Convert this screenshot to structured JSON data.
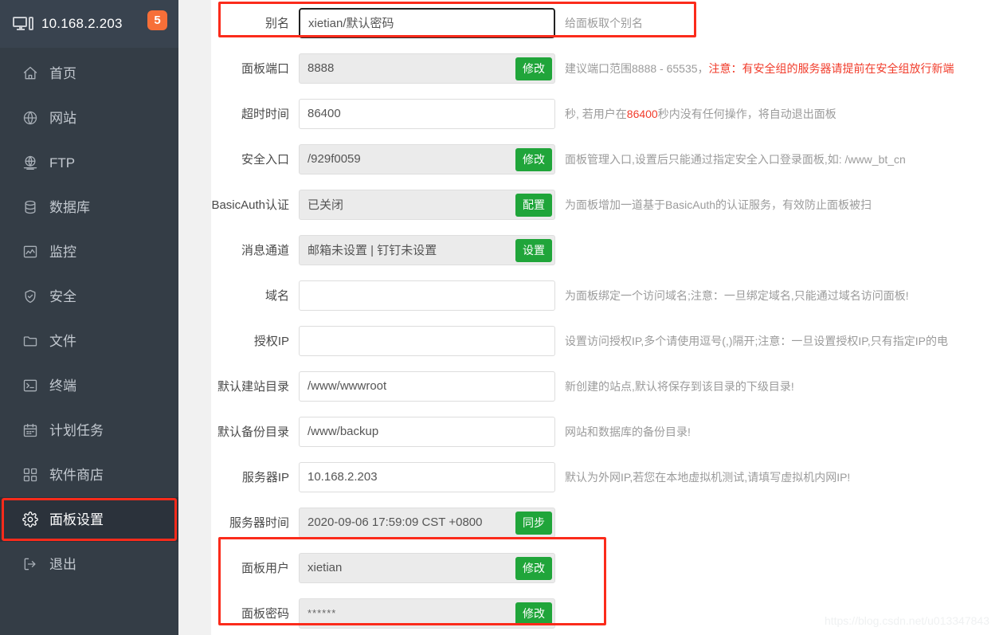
{
  "sidebar": {
    "host": "10.168.2.203",
    "badge": "5",
    "host_icon": "monitor-tower-icon",
    "items": [
      {
        "label": "首页",
        "icon": "home-icon",
        "active": false
      },
      {
        "label": "网站",
        "icon": "globe-icon",
        "active": false
      },
      {
        "label": "FTP",
        "icon": "ftp-globe-icon",
        "active": false
      },
      {
        "label": "数据库",
        "icon": "database-icon",
        "active": false
      },
      {
        "label": "监控",
        "icon": "chart-icon",
        "active": false
      },
      {
        "label": "安全",
        "icon": "shield-icon",
        "active": false
      },
      {
        "label": "文件",
        "icon": "folder-icon",
        "active": false
      },
      {
        "label": "终端",
        "icon": "terminal-icon",
        "active": false
      },
      {
        "label": "计划任务",
        "icon": "calendar-icon",
        "active": false
      },
      {
        "label": "软件商店",
        "icon": "grid-icon",
        "active": false
      },
      {
        "label": "面板设置",
        "icon": "gear-icon",
        "active": true
      },
      {
        "label": "退出",
        "icon": "logout-icon",
        "active": false
      }
    ]
  },
  "form": {
    "rows": [
      {
        "label": "别名",
        "value": "xietian/默认密码",
        "readonly": false,
        "focused": true,
        "button": null,
        "hint": "给面板取个别名",
        "hint_warn": null,
        "annotated": true
      },
      {
        "label": "面板端口",
        "value": "8888",
        "readonly": true,
        "focused": false,
        "button": "修改",
        "hint": "建议端口范围8888 - 65535，",
        "hint_warn": "注意：有安全组的服务器请提前在安全组放行新端",
        "annotated": false
      },
      {
        "label": "超时时间",
        "value": "86400",
        "readonly": false,
        "focused": false,
        "button": null,
        "hint": "秒, 若用户在",
        "hint_num": "86400",
        "hint_tail": "秒内没有任何操作，将自动退出面板",
        "annotated": false
      },
      {
        "label": "安全入口",
        "value": "/929f0059",
        "readonly": true,
        "focused": false,
        "button": "修改",
        "hint": "面板管理入口,设置后只能通过指定安全入口登录面板,如: /www_bt_cn",
        "annotated": false
      },
      {
        "label": "BasicAuth认证",
        "value": "已关闭",
        "readonly": true,
        "focused": false,
        "button": "配置",
        "hint": "为面板增加一道基于BasicAuth的认证服务，有效防止面板被扫",
        "annotated": false
      },
      {
        "label": "消息通道",
        "value": "邮箱未设置 | 钉钉未设置",
        "readonly": true,
        "focused": false,
        "button": "设置",
        "hint": "",
        "annotated": false
      },
      {
        "label": "域名",
        "value": "",
        "readonly": false,
        "focused": false,
        "button": null,
        "hint": "为面板绑定一个访问域名;注意：一旦绑定域名,只能通过域名访问面板!",
        "annotated": false
      },
      {
        "label": "授权IP",
        "value": "",
        "readonly": false,
        "focused": false,
        "button": null,
        "hint": "设置访问授权IP,多个请使用逗号(,)隔开;注意：一旦设置授权IP,只有指定IP的电",
        "annotated": false
      },
      {
        "label": "默认建站目录",
        "value": "/www/wwwroot",
        "readonly": false,
        "focused": false,
        "button": null,
        "hint": "新创建的站点,默认将保存到该目录的下级目录!",
        "annotated": false
      },
      {
        "label": "默认备份目录",
        "value": "/www/backup",
        "readonly": false,
        "focused": false,
        "button": null,
        "hint": "网站和数据库的备份目录!",
        "annotated": false
      },
      {
        "label": "服务器IP",
        "value": "10.168.2.203",
        "readonly": false,
        "focused": false,
        "button": null,
        "hint": "默认为外网IP,若您在本地虚拟机测试,请填写虚拟机内网IP!",
        "annotated": false
      },
      {
        "label": "服务器时间",
        "value": "2020-09-06 17:59:09 CST +0800",
        "readonly": true,
        "focused": false,
        "button": "同步",
        "hint": "",
        "annotated": false
      },
      {
        "label": "面板用户",
        "value": "xietian",
        "readonly": true,
        "focused": false,
        "button": "修改",
        "hint": "",
        "annotated": true
      },
      {
        "label": "面板密码",
        "value": "******",
        "readonly": true,
        "focused": false,
        "button": "修改",
        "hint": "",
        "annotated": true
      }
    ]
  },
  "watermark": "https://blog.csdn.net/u013347843",
  "colors": {
    "sidebar_bg": "#343d46",
    "sidebar_header_bg": "#39434f",
    "sidebar_active_bg": "#2b323b",
    "badge_orange": "#f76f38",
    "button_green": "#20a53a",
    "annotation_red": "#fb2b1b",
    "hint_warn_red": "#f13c2b",
    "gutter_gray": "#f1f1f1"
  }
}
